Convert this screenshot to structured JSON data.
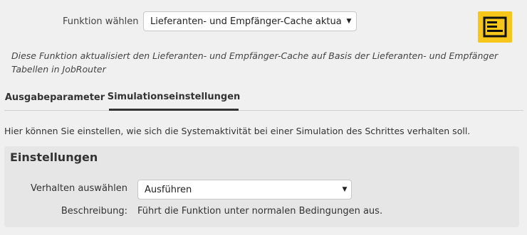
{
  "function_row": {
    "label": "Funktion wählen",
    "selected": "Lieferanten- und Empfänger-Cache aktualisie",
    "arrow": "▼"
  },
  "module_icon": {
    "name": "module-list-icon",
    "color": "#f7c61a"
  },
  "function_description": "Diese Funktion aktualisiert den Lieferanten- und Empfänger-Cache auf Basis der Lieferanten- und Empfänger Tabellen in JobRouter",
  "tabs": [
    {
      "label": "Ausgabeparameter",
      "active": false
    },
    {
      "label": "Simulationseinstellungen",
      "active": true
    }
  ],
  "info_text": "Hier können Sie einstellen, wie sich die Systemaktivität bei einer Simulation des Schrittes verhalten soll.",
  "settings": {
    "title": "Einstellungen",
    "behavior_label": "Verhalten auswählen",
    "behavior_selected": "Ausführen",
    "behavior_arrow": "▼",
    "description_label": "Beschreibung:",
    "description_value": "Führt die Funktion unter normalen Bedingungen aus."
  }
}
